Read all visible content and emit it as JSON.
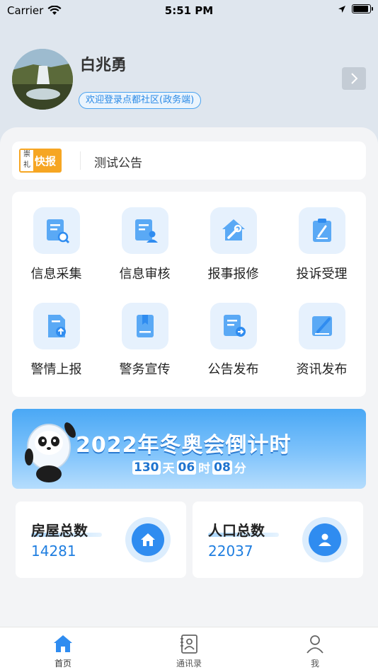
{
  "status_bar": {
    "carrier": "Carrier",
    "time": "5:51 PM"
  },
  "profile": {
    "name": "白兆勇",
    "welcome": "欢迎登录点都社区(政务端)"
  },
  "notice": {
    "logo_text_1": "崇礼",
    "logo_text_2": "快报",
    "text": "测试公告"
  },
  "menu": {
    "items": [
      {
        "label": "信息采集",
        "icon": "info-collect-icon"
      },
      {
        "label": "信息审核",
        "icon": "info-review-icon"
      },
      {
        "label": "报事报修",
        "icon": "repair-report-icon"
      },
      {
        "label": "投诉受理",
        "icon": "complaint-icon"
      },
      {
        "label": "警情上报",
        "icon": "alert-report-icon"
      },
      {
        "label": "警务宣传",
        "icon": "police-publicity-icon"
      },
      {
        "label": "公告发布",
        "icon": "announcement-icon"
      },
      {
        "label": "资讯发布",
        "icon": "news-publish-icon"
      }
    ]
  },
  "banner": {
    "title": "2022年冬奥会倒计时",
    "days": "130",
    "days_unit": "天",
    "hours": "06",
    "hours_unit": "时",
    "minutes": "08",
    "minutes_unit": "分"
  },
  "stats": [
    {
      "title": "房屋总数",
      "value": "14281",
      "icon": "house-icon"
    },
    {
      "title": "人口总数",
      "value": "22037",
      "icon": "person-icon"
    }
  ],
  "tabs": [
    {
      "label": "首页",
      "icon": "home-icon"
    },
    {
      "label": "通讯录",
      "icon": "contacts-icon"
    },
    {
      "label": "我",
      "icon": "profile-icon"
    }
  ],
  "colors": {
    "accent": "#2f8cf0",
    "background": "#dfe6ee",
    "panel": "#f3f4f6"
  }
}
